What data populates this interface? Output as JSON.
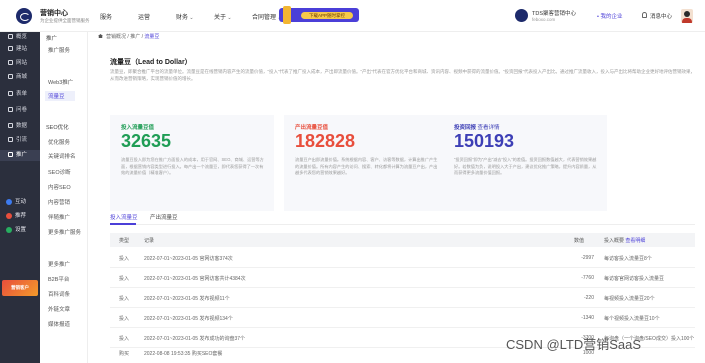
{
  "brand": {
    "title": "营销中心",
    "subtitle": "为企业提供全面营销服务"
  },
  "top_nav": [
    {
      "label": "服务",
      "has_arrow": false
    },
    {
      "label": "运营",
      "has_arrow": false
    },
    {
      "label": "财务",
      "has_arrow": true
    },
    {
      "label": "关于",
      "has_arrow": true
    },
    {
      "label": "合同管理",
      "has_arrow": true
    }
  ],
  "promo": {
    "label": "下载APP随时掌控"
  },
  "right_brand": {
    "name": "TDS聚客营销中心",
    "domain": "feboxo.com"
  },
  "user": {
    "center_label": "• 我的企业",
    "message_label": "消息中心"
  },
  "sidebar": {
    "items": [
      {
        "label": "概览"
      },
      {
        "label": "建站"
      },
      {
        "label": "网站"
      },
      {
        "label": "商城"
      },
      {
        "label": "表单"
      },
      {
        "label": "问卷"
      },
      {
        "label": "数据"
      },
      {
        "label": "引流"
      },
      {
        "label": "推广"
      }
    ],
    "round_items": [
      {
        "label": "互动",
        "color": "#3d7bf0"
      },
      {
        "label": "推荐",
        "color": "#e84e3c"
      },
      {
        "label": "设置",
        "color": "#27ae60"
      }
    ],
    "banner": "营销客户"
  },
  "subnav": {
    "groups": [
      "推广",
      "SEO优化"
    ],
    "items_a": [
      "推广服务",
      "Web3推广",
      "流量豆"
    ],
    "items_b": [
      "优化服务",
      "关键词排名",
      "SEO诊断",
      "内容SEO",
      "内容营销",
      "伴随推广",
      "更多推广服务",
      "更多推广",
      "B2B平台",
      "百科词条",
      "外链文章",
      "媒体报道"
    ]
  },
  "breadcrumb": {
    "home": "营销概况",
    "parent": "推广",
    "current": "流量豆"
  },
  "page": {
    "title": "流量豆（Lead to Dollar）",
    "intro": "流量豆，即聚合推广平台的流量单位。流量豆是在线营销内容产生的流量价值，“投入”代表了推广投入成本，产出即流量价值。“产出”代表在官方优化平台和商城、资讯内容、视频中获得的流量价值。“投资回报”代表投入产出比。通过推广流量收入，投入与产出比将帮助企业更好地评估营销效果，从而改进营销策略，实现营销价值的增长。"
  },
  "stats": [
    {
      "label": "投入流量豆值",
      "value": "32635",
      "color": "#1f9d55",
      "desc": "流量豆投入即为您在推广方面投入的成本，用于官网、SEO、商城、运营等方面，根据营销内容类型进行投入。每产出一个流量豆，即代表您获得了一次有效的流量价值（精准客户）。"
    },
    {
      "label": "产出流量豆值",
      "value": "182828",
      "color": "#e84e3c",
      "desc": "流量豆产出即流量价值。系统根据内容、客户、访客等数据，计算出推广产生的流量价值。所有内容产生的访问、搜索、转化都将计算为流量豆产出，产出越多代表您的营销效果越好。"
    },
    {
      "label": "投资回报",
      "value": "150193",
      "color": "#3d3fb6",
      "link": "查看详情",
      "desc": "“投资回报”即为“产出”减去“投入”的差值。投资回报数值越大，代表营销效果越好。若数值为负，说明投入大于产出，建议优化推广策略，提升内容质量，从而获得更多流量价值回报。"
    }
  ],
  "tabs": [
    "投入流量豆",
    "产出流量豆"
  ],
  "table": {
    "headers": {
      "type": "类型",
      "record": "记录",
      "amount": "数值",
      "remark": "投入概要",
      "link": "查看明细"
    },
    "rows": [
      {
        "type": "投入",
        "record": "2022-07-01~2023-01-05 官网访客374次",
        "amount": "-2997",
        "remark": "每访客投入流量豆8个"
      },
      {
        "type": "投入",
        "record": "2022-07-01~2023-01-05 官网访客共计4384次",
        "amount": "-7760",
        "remark": "每访客官网访客投入流量豆"
      },
      {
        "type": "投入",
        "record": "2022-07-01~2023-01-05 发布视频11个",
        "amount": "-220",
        "remark": "每视频投入流量豆20个"
      },
      {
        "type": "投入",
        "record": "2022-07-01~2023-01-05 发布视频134个",
        "amount": "-1340",
        "remark": "每个视频投入流量豆10个"
      },
      {
        "type": "投入",
        "record": "2022-07-01~2023-01-05 发布成功的询盘37个",
        "amount": "-3700",
        "remark": "每询盘（一个询盘/SEO成交）投入100个流量豆"
      },
      {
        "type": "购买",
        "record": "2022-08-08 19:53:35 购买SEO套餐",
        "amount": "1000",
        "remark": ""
      }
    ]
  },
  "watermark": "CSDN @LTD营销SaaS"
}
